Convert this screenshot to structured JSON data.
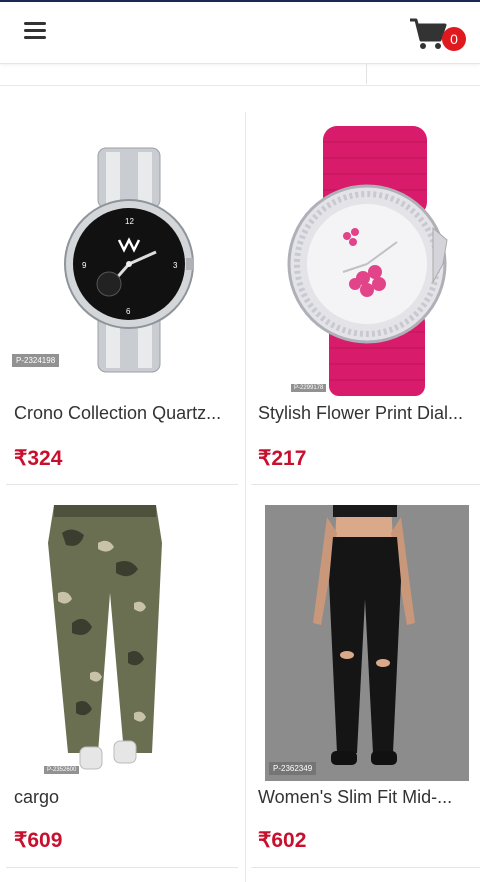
{
  "header": {
    "cart_count": "0"
  },
  "products": [
    {
      "id": "P-2324198",
      "title": "Crono Collection Quartz...",
      "price": "₹324"
    },
    {
      "id": "P-2299178",
      "title": "Stylish Flower Print Dial...",
      "price": "₹217"
    },
    {
      "id": "P-2352600",
      "title": "cargo",
      "price": "₹609"
    },
    {
      "id": "P-2362349",
      "title": "Women's Slim Fit Mid-...",
      "price": "₹602"
    }
  ],
  "icons": {
    "menu": "hamburger-icon",
    "cart": "cart-icon"
  },
  "colors": {
    "price": "#c8102e",
    "badge": "#e0191f"
  }
}
